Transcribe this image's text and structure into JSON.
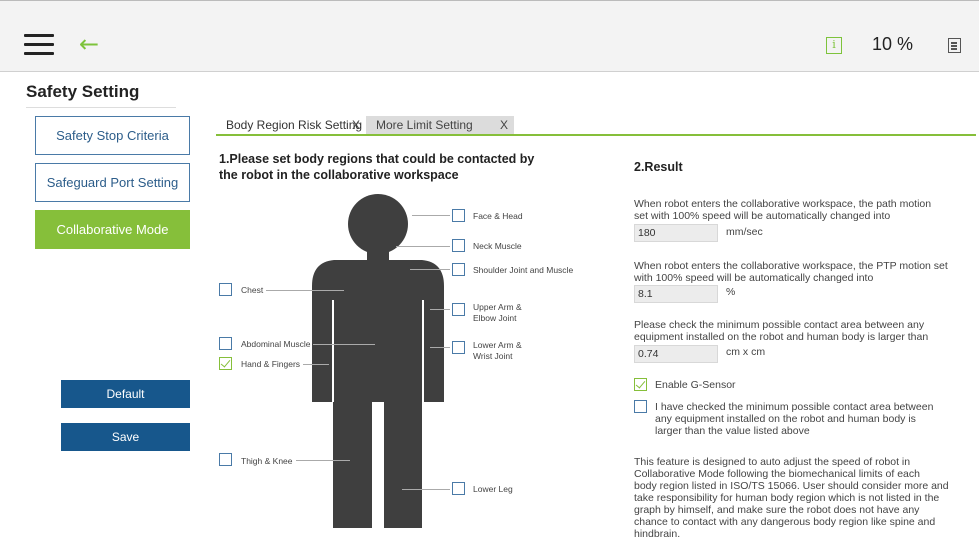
{
  "header": {
    "speed": "10 %",
    "icons": [
      "menu-icon",
      "back-arrow-icon",
      "info-icon",
      "speed-panel-icon"
    ],
    "accent_color": "#7dc33b"
  },
  "page": {
    "title": "Safety Setting"
  },
  "sidebar": {
    "items": [
      {
        "label": "Safety Stop Criteria",
        "active": false
      },
      {
        "label": "Safeguard Port Setting",
        "active": false
      },
      {
        "label": "Collaborative Mode",
        "active": true
      }
    ],
    "default_label": "Default",
    "save_label": "Save",
    "active_color": "#86bf3a",
    "button_color": "#17578c"
  },
  "tabs": [
    {
      "label": "Body Region Risk Setting",
      "close": "X"
    },
    {
      "label": "More Limit Setting",
      "close": "X"
    }
  ],
  "body_regions": {
    "heading_line1": "1.Please set body regions that could be contacted by",
    "heading_line2": "the robot in the collaborative workspace",
    "items": [
      {
        "label": "Face & Head",
        "checked": false
      },
      {
        "label": "Neck Muscle",
        "checked": false
      },
      {
        "label": "Shoulder Joint and Muscle",
        "checked": false
      },
      {
        "label": "Chest",
        "checked": false
      },
      {
        "label": "Upper Arm &",
        "label2": "Elbow Joint",
        "checked": false
      },
      {
        "label": "Abdominal Muscle",
        "checked": false
      },
      {
        "label": "Lower Arm &",
        "label2": "Wrist Joint",
        "checked": false
      },
      {
        "label": "Hand & Fingers",
        "checked": true
      },
      {
        "label": "Thigh & Knee",
        "checked": false
      },
      {
        "label": "Lower Leg",
        "checked": false
      }
    ]
  },
  "result": {
    "heading": "2.Result",
    "path_text1": "When robot enters the collaborative workspace, the path motion",
    "path_text2": "set with 100% speed will be automatically changed into",
    "path_value": "180",
    "path_unit": "mm/sec",
    "ptp_text1": "When robot enters the collaborative workspace, the PTP motion set",
    "ptp_text2": "with 100% speed will be automatically changed into",
    "ptp_value": "8.1",
    "ptp_unit": "%",
    "area_text1": "Please check the minimum possible contact area between any",
    "area_text2": "equipment installed on the robot and human body is larger than",
    "area_value": "0.74",
    "area_unit": "cm x cm",
    "gsensor_label": "Enable G-Sensor",
    "gsensor_checked": true,
    "confirm_line1": "I have checked the minimum possible contact area between",
    "confirm_line2": "any equipment installed on the robot and human body is",
    "confirm_line3": "larger than the value listed above",
    "confirm_checked": false,
    "note_lines": [
      "This feature is designed to auto adjust the speed of robot in",
      "Collaborative Mode following the biomechanical limits of each",
      "body region listed in ISO/TS 15066. User should consider more and",
      "take responsibility for human body region which is not listed in the",
      "graph by himself, and make sure the robot does not have any",
      "chance to contact with any dangerous body region like spine and",
      "hindbrain."
    ]
  }
}
